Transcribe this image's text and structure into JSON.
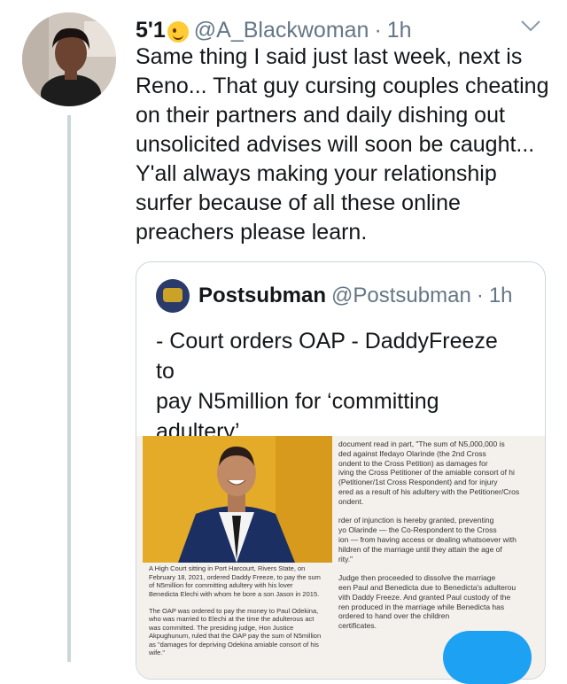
{
  "tweet": {
    "name": "5'1",
    "name_emoji": "winking-face-emoji",
    "handle": "@A_Blackwoman",
    "separator": "·",
    "time": "1h",
    "text": "Same thing I said just last week, next is\nReno... That guy cursing couples cheating\non their partners and daily dishing out\nunsolicited advises will soon be caught...\nY'all always making your relationship\nsurfer because of all these online\npreachers please learn."
  },
  "quoted": {
    "name": "Postsubman",
    "handle": "@Postsubman",
    "separator": "·",
    "time": "1h",
    "text": "- Court orders OAP - DaddyFreeze to\npay N5million for ‘committing\nadultery’",
    "image": {
      "caption": "A High Court sitting in Port Harcourt, Rivers State, on\nFebruary 18, 2021, ordered Daddy Freeze, to pay the sum\nof N5million for committing adultery with his lover\nBenedicta Elechi with whom he bore a son Jason in 2015.\n\nThe OAP was ordered to pay the money to Paul Odekina,\nwho was married to Elechi at the time the adulterous act\nwas committed. The presiding judge, Hon Justice\nAkpughunum, ruled that the OAP pay the sum of N5million\nas \"damages for depriving Odekina amiable consort of his\nwife.\"",
      "article": "document read in part, \"The sum of N5,000,000 is\nded against Ifedayo Olarinde (the 2nd Cross\nondent to the Cross Petition) as damages for\niving the Cross Petitioner of the amiable consort of hi\n(Petitioner/1st Cross Respondent) and for injury\nered as a result of his adultery with the Petitioner/Cros\nondent.\n\nrder of injunction is hereby granted, preventing\nyo Olarinde — the Co-Respondent to the Cross\nion — from having access or dealing whatsoever with\nhildren of the marriage until they attain the age of\nrity.\"\n\nJudge then proceeded to dissolve the marriage\neen Paul and Benedicta due to Benedicta's adulterou\nvith Daddy Freeze. And granted Paul custody of the\nren produced in the marriage while Benedicta has\n ordered to hand over the children\n certificates."
    }
  },
  "colors": {
    "text": "#14171a",
    "muted": "#657786",
    "border": "#ccd6dd",
    "accent": "#1da1f2"
  }
}
